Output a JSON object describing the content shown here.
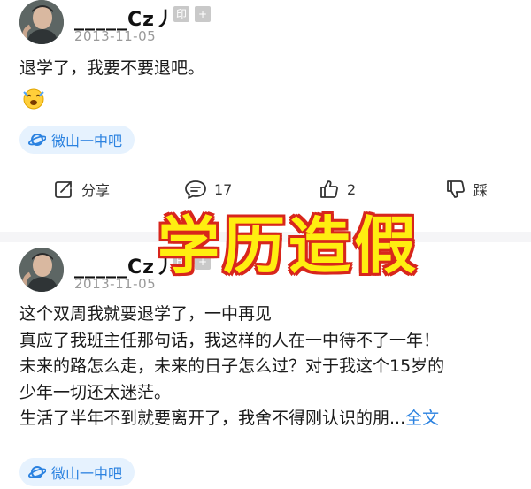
{
  "posts": [
    {
      "username": "_____Cz丿",
      "badge": "印",
      "badge2": "+",
      "date": "2013-11-05",
      "lines": [
        "退学了，我要不要退吧。"
      ],
      "emoji": "😭",
      "forum": "微山一中吧",
      "actions": {
        "share": "分享",
        "comments": "17",
        "likes": "2",
        "dislike": "踩"
      }
    },
    {
      "username": "_____Cz丿",
      "badge": "印",
      "badge2": "+",
      "date": "2013-11-05",
      "lines": [
        "这个双周我就要退学了，一中再见",
        "真应了我班主任那句话，我这样的人在一中待不了一年！",
        "未来的路怎么走，未来的日子怎么过？对于我这个15岁的",
        "少年一切还太迷茫。",
        "生活了半年不到就要离开了，我舍不得刚认识的朋..."
      ],
      "more_link": "全文",
      "forum": "微山一中吧"
    }
  ],
  "overlay_caption": "学历造假",
  "colors": {
    "link": "#2b82e0",
    "tag_bg": "#e6f2fe",
    "caption_fill": "#ffee10",
    "caption_stroke": "#d8261c"
  }
}
